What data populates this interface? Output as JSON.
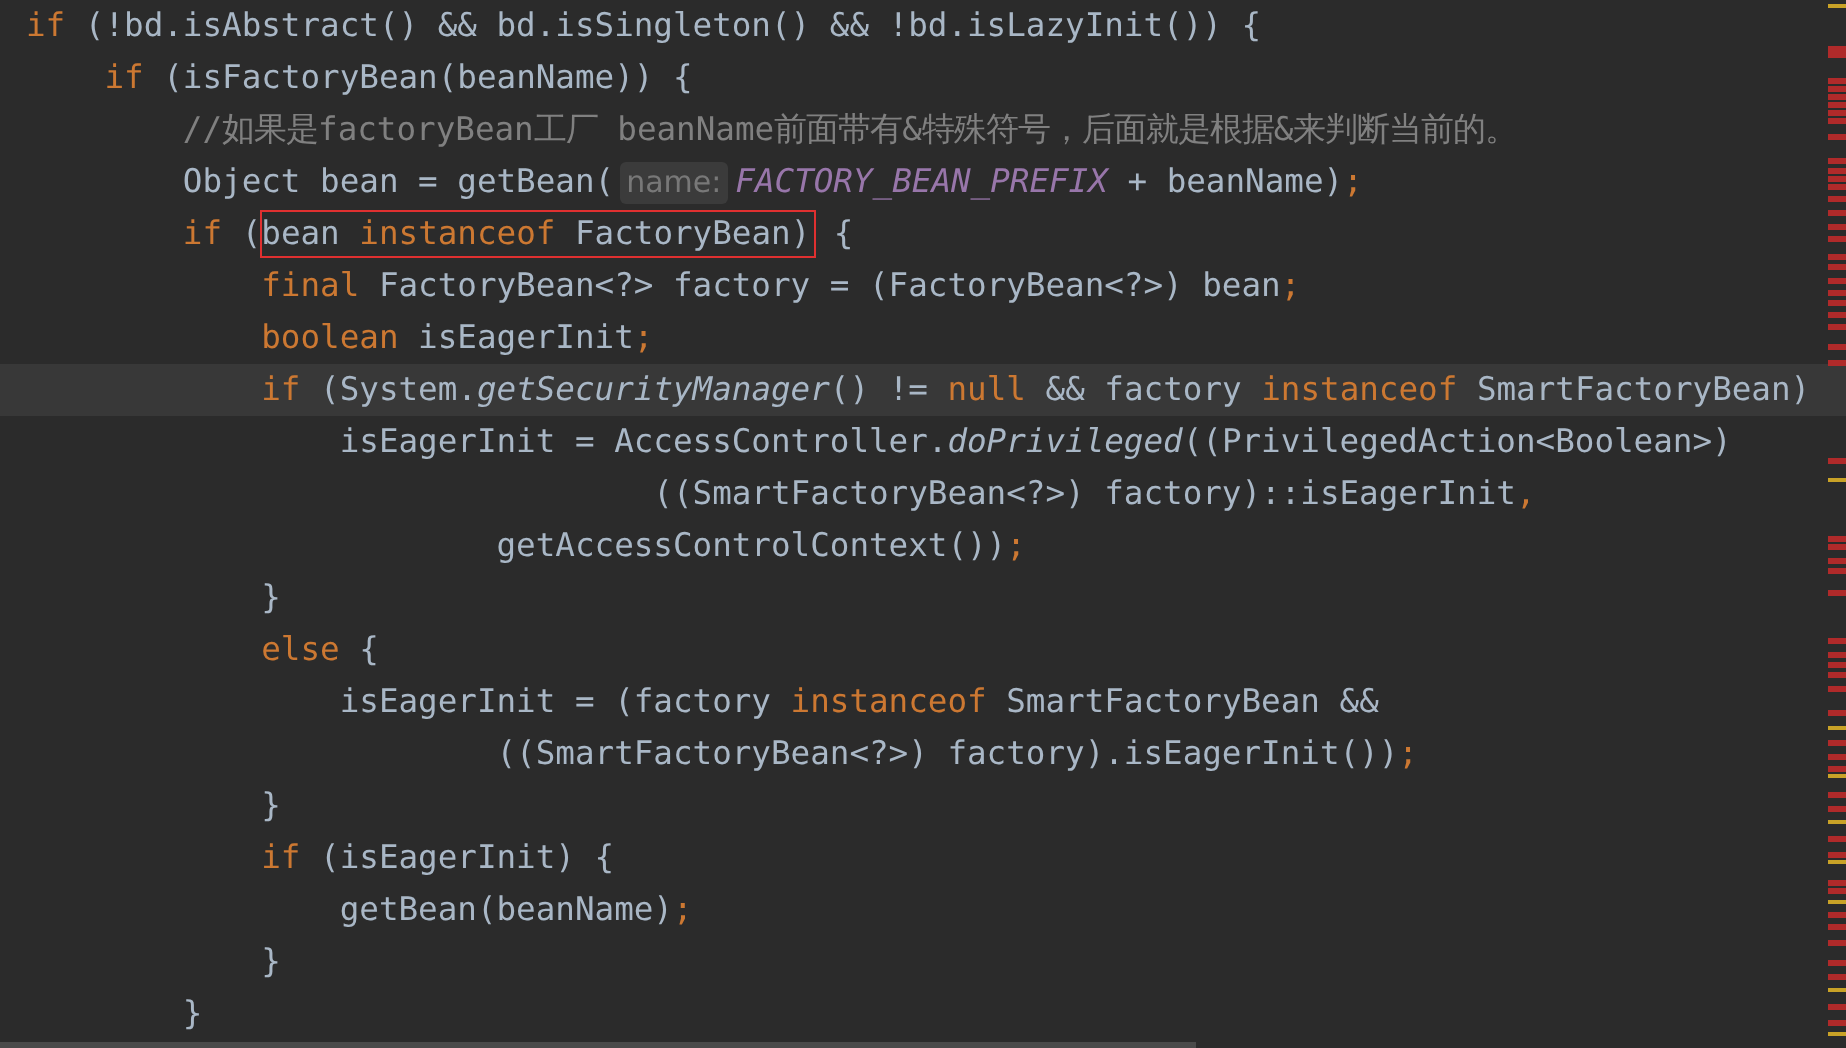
{
  "editor": {
    "lines": [
      {
        "current": false,
        "segments": [
          {
            "kind": "code",
            "tokens": [
              {
                "kind": "kw",
                "text": "if"
              },
              {
                "kind": "plain",
                "text": " (!bd.isAbstract() && bd.isSingleton() && !bd.isLazyInit()) {"
              }
            ]
          }
        ]
      },
      {
        "current": false,
        "segments": [
          {
            "kind": "code",
            "tokens": [
              {
                "kind": "kw",
                "text": "    if"
              },
              {
                "kind": "plain",
                "text": " (isFactoryBean(beanName)) {"
              }
            ]
          }
        ]
      },
      {
        "current": false,
        "segments": [
          {
            "kind": "code",
            "tokens": [
              {
                "kind": "comment",
                "text": "        //如果是factoryBean工厂 beanName前面带有&特殊符号，后面就是根据&来判断当前的。"
              }
            ]
          }
        ]
      },
      {
        "current": false,
        "segments": [
          {
            "kind": "code",
            "tokens": [
              {
                "kind": "plain",
                "text": "        Object bean = getBean("
              }
            ]
          },
          {
            "kind": "hint",
            "text": "name:"
          },
          {
            "kind": "code",
            "tokens": [
              {
                "kind": "const",
                "text": "FACTORY_BEAN_PREFIX"
              },
              {
                "kind": "plain",
                "text": " + beanName)"
              },
              {
                "kind": "punct",
                "text": ";"
              }
            ]
          }
        ]
      },
      {
        "current": false,
        "segments": [
          {
            "kind": "code",
            "tokens": [
              {
                "kind": "kw",
                "text": "        if"
              },
              {
                "kind": "plain",
                "text": " ("
              }
            ]
          },
          {
            "kind": "boxed",
            "tokens": [
              {
                "kind": "plain",
                "text": "bean "
              },
              {
                "kind": "kw",
                "text": "instanceof"
              },
              {
                "kind": "plain",
                "text": " FactoryBean)"
              }
            ]
          },
          {
            "kind": "code",
            "tokens": [
              {
                "kind": "plain",
                "text": " {"
              }
            ]
          }
        ]
      },
      {
        "current": false,
        "segments": [
          {
            "kind": "code",
            "tokens": [
              {
                "kind": "kw",
                "text": "            final"
              },
              {
                "kind": "plain",
                "text": " FactoryBean<?> factory = (FactoryBean<?>) bean"
              },
              {
                "kind": "punct",
                "text": ";"
              }
            ]
          }
        ]
      },
      {
        "current": false,
        "segments": [
          {
            "kind": "code",
            "tokens": [
              {
                "kind": "kw",
                "text": "            boolean"
              },
              {
                "kind": "plain",
                "text": " isEagerInit"
              },
              {
                "kind": "punct",
                "text": ";"
              }
            ]
          }
        ]
      },
      {
        "current": true,
        "segments": [
          {
            "kind": "code",
            "tokens": [
              {
                "kind": "kw",
                "text": "            if"
              },
              {
                "kind": "plain",
                "text": " (System."
              },
              {
                "kind": "method",
                "text": "getSecurityManager"
              },
              {
                "kind": "plain",
                "text": "() != "
              },
              {
                "kind": "kw",
                "text": "null"
              },
              {
                "kind": "plain",
                "text": " && factory "
              },
              {
                "kind": "kw",
                "text": "instanceof"
              },
              {
                "kind": "plain",
                "text": " SmartFactoryBean)"
              }
            ]
          }
        ]
      },
      {
        "current": false,
        "segments": [
          {
            "kind": "code",
            "tokens": [
              {
                "kind": "plain",
                "text": "                isEagerInit = AccessController."
              },
              {
                "kind": "method",
                "text": "doPrivileged"
              },
              {
                "kind": "plain",
                "text": "((PrivilegedAction<Boolean>)"
              }
            ]
          }
        ]
      },
      {
        "current": false,
        "segments": [
          {
            "kind": "code",
            "tokens": [
              {
                "kind": "plain",
                "text": "                                ((SmartFactoryBean<?>) factory)::isEagerInit"
              },
              {
                "kind": "punct",
                "text": ","
              }
            ]
          }
        ]
      },
      {
        "current": false,
        "segments": [
          {
            "kind": "code",
            "tokens": [
              {
                "kind": "plain",
                "text": "                        getAccessControlContext())"
              },
              {
                "kind": "punct",
                "text": ";"
              }
            ]
          }
        ]
      },
      {
        "current": false,
        "segments": [
          {
            "kind": "code",
            "tokens": [
              {
                "kind": "plain",
                "text": "            }"
              }
            ]
          }
        ]
      },
      {
        "current": false,
        "segments": [
          {
            "kind": "code",
            "tokens": [
              {
                "kind": "kw",
                "text": "            else"
              },
              {
                "kind": "plain",
                "text": " {"
              }
            ]
          }
        ]
      },
      {
        "current": false,
        "segments": [
          {
            "kind": "code",
            "tokens": [
              {
                "kind": "plain",
                "text": "                isEagerInit = (factory "
              },
              {
                "kind": "kw",
                "text": "instanceof"
              },
              {
                "kind": "plain",
                "text": " SmartFactoryBean &&"
              }
            ]
          }
        ]
      },
      {
        "current": false,
        "segments": [
          {
            "kind": "code",
            "tokens": [
              {
                "kind": "plain",
                "text": "                        ((SmartFactoryBean<?>) factory).isEagerInit())"
              },
              {
                "kind": "punct",
                "text": ";"
              }
            ]
          }
        ]
      },
      {
        "current": false,
        "segments": [
          {
            "kind": "code",
            "tokens": [
              {
                "kind": "plain",
                "text": "            }"
              }
            ]
          }
        ]
      },
      {
        "current": false,
        "segments": [
          {
            "kind": "code",
            "tokens": [
              {
                "kind": "kw",
                "text": "            if"
              },
              {
                "kind": "plain",
                "text": " (isEagerInit) {"
              }
            ]
          }
        ]
      },
      {
        "current": false,
        "segments": [
          {
            "kind": "code",
            "tokens": [
              {
                "kind": "plain",
                "text": "                getBean(beanName)"
              },
              {
                "kind": "punct",
                "text": ";"
              }
            ]
          }
        ]
      },
      {
        "current": false,
        "segments": [
          {
            "kind": "code",
            "tokens": [
              {
                "kind": "plain",
                "text": "            }"
              }
            ]
          }
        ]
      },
      {
        "current": false,
        "segments": [
          {
            "kind": "code",
            "tokens": [
              {
                "kind": "plain",
                "text": "        }"
              }
            ]
          }
        ]
      }
    ]
  }
}
